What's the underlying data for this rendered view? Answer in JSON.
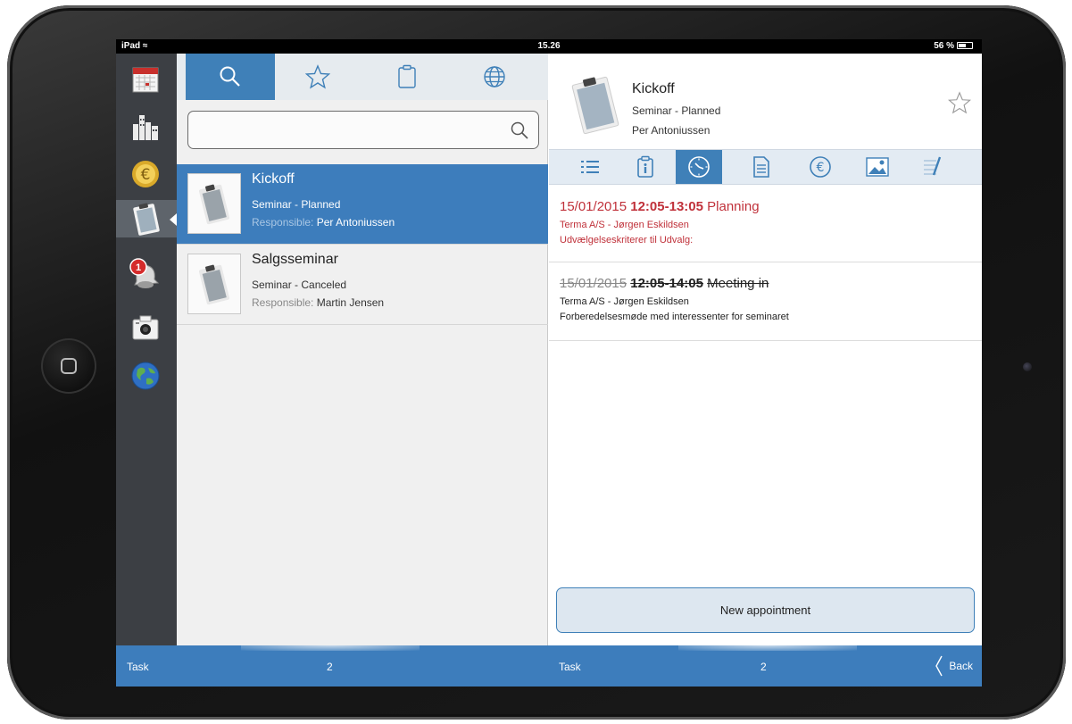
{
  "statusbar": {
    "device": "iPad",
    "time": "15.26",
    "battery": "56 %"
  },
  "sidebar": {
    "items": [
      {
        "icon": "calendar-icon",
        "badge": ""
      },
      {
        "icon": "buildings-icon",
        "badge": ""
      },
      {
        "icon": "euro-coin-icon",
        "badge": ""
      },
      {
        "icon": "clipboard-icon",
        "badge": ""
      },
      {
        "icon": "bell-icon",
        "badge": "1"
      },
      {
        "icon": "camera-icon",
        "badge": ""
      },
      {
        "icon": "globe-icon",
        "badge": ""
      }
    ]
  },
  "list": {
    "tabs": [
      "search-icon",
      "star-icon",
      "clipboard-icon",
      "globe-icon"
    ],
    "search": {
      "value": "",
      "placeholder": ""
    },
    "responsible_label": "Responsible:",
    "items": [
      {
        "title": "Kickoff",
        "subtitle": "Seminar - Planned",
        "responsible": "Per Antoniussen"
      },
      {
        "title": "Salgsseminar",
        "subtitle": "Seminar - Canceled",
        "responsible": "Martin Jensen"
      }
    ]
  },
  "detail": {
    "title": "Kickoff",
    "subtitle": "Seminar - Planned",
    "responsible": "Per Antoniussen",
    "tabs": [
      "list-icon",
      "info-icon",
      "clock-icon",
      "document-icon",
      "euro-icon",
      "image-icon",
      "notes-icon"
    ],
    "appointments": [
      {
        "date": "15/01/2015",
        "time": "12:05-13:05",
        "subject": "Planning",
        "contact": "Terma A/S - Jørgen Eskildsen",
        "note": "Udvælgelseskriterer til Udvalg:"
      },
      {
        "date": "15/01/2015",
        "time": "12:05-14:05",
        "subject": "Meeting in",
        "contact": "Terma A/S - Jørgen Eskildsen",
        "note": "Forberedelsesmøde med interessenter for seminaret"
      }
    ],
    "new_appointment_label": "New appointment"
  },
  "footer": {
    "left": {
      "label": "Task",
      "count": "2"
    },
    "right": {
      "label": "Task",
      "count": "2",
      "back_label": "Back"
    }
  },
  "colors": {
    "accent": "#3d7dbc",
    "sidebar": "#3c3f44",
    "alert": "#c0313a"
  }
}
